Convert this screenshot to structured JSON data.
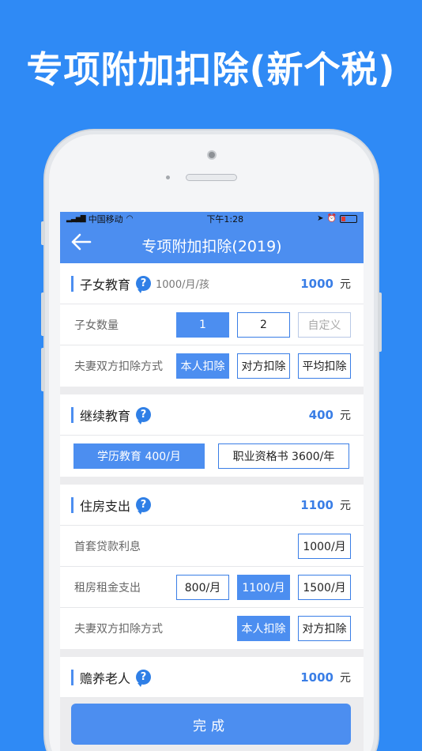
{
  "banner": {
    "title": "专项附加扣除(新个税)"
  },
  "status_bar": {
    "carrier": "中国移动",
    "time": "下午1:28"
  },
  "nav": {
    "back_icon": "back-arrow-icon",
    "title": "专项附加扣除(2019)"
  },
  "children_edu": {
    "title": "子女教育",
    "help": "?",
    "subtitle": "1000/月/孩",
    "amount": "1000",
    "unit": "元",
    "count_label": "子女数量",
    "count_options": [
      "1",
      "2",
      "自定义"
    ],
    "count_selected": "1",
    "split_label": "夫妻双方扣除方式",
    "split_options": [
      "本人扣除",
      "对方扣除",
      "平均扣除"
    ],
    "split_selected": "本人扣除"
  },
  "continuing_edu": {
    "title": "继续教育",
    "help": "?",
    "amount": "400",
    "unit": "元",
    "options": [
      "学历教育 400/月",
      "职业资格书 3600/年"
    ],
    "selected": "学历教育 400/月"
  },
  "housing": {
    "title": "住房支出",
    "help": "?",
    "amount": "1100",
    "unit": "元",
    "loan_label": "首套贷款利息",
    "loan_option": "1000/月",
    "rent_label": "租房租金支出",
    "rent_options": [
      "800/月",
      "1100/月",
      "1500/月"
    ],
    "rent_selected": "1100/月",
    "split_label": "夫妻双方扣除方式",
    "split_options": [
      "本人扣除",
      "对方扣除"
    ],
    "split_selected": "本人扣除"
  },
  "elderly": {
    "title": "赡养老人",
    "help": "?",
    "amount": "1000",
    "unit": "元"
  },
  "done_button": "完成",
  "colors": {
    "background": "#2f8af5",
    "accent": "#4c8ef0",
    "amount": "#3a7ee6"
  }
}
